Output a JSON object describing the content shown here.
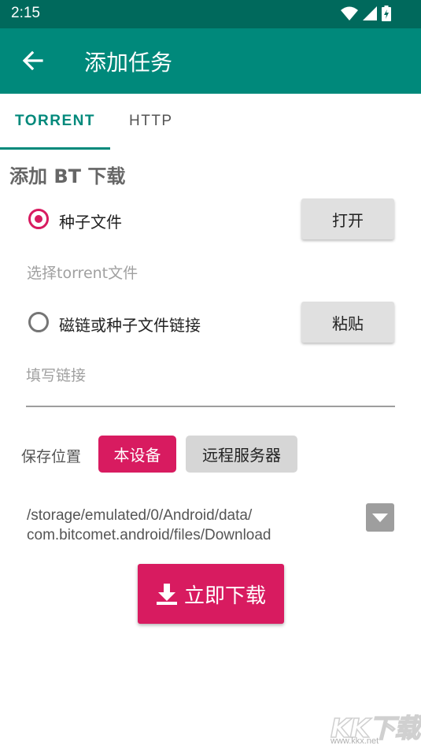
{
  "status_bar": {
    "time": "2:15",
    "icons": [
      "wifi-icon",
      "signal-icon",
      "battery-icon"
    ]
  },
  "app_bar": {
    "title": "添加任务",
    "back_icon": "arrow-left-icon"
  },
  "tabs": [
    {
      "label": "TORRENT",
      "selected": true
    },
    {
      "label": "HTTP",
      "selected": false
    }
  ],
  "section_title": "添加 BT 下载",
  "torrent_file": {
    "label": "种子文件",
    "selected": true,
    "button": "打开",
    "hint": "选择torrent文件"
  },
  "magnet": {
    "label": "磁链或种子文件链接",
    "selected": false,
    "button": "粘贴",
    "placeholder": "填写链接"
  },
  "save_location": {
    "label": "保存位置",
    "device_button": "本设备",
    "remote_button": "远程服务器"
  },
  "path": {
    "value": "/storage/emulated/0/Android/data/com.bitcomet.android/files/Download"
  },
  "download_button": {
    "label": "立即下载",
    "icon": "download-icon"
  },
  "watermark": {
    "text": "KK下载",
    "url": "www.kkx.net"
  },
  "colors": {
    "status_bar": "#00695c",
    "app_bar": "#00897b",
    "accent": "#d81b60",
    "button_grey": "#e0e0e0"
  }
}
